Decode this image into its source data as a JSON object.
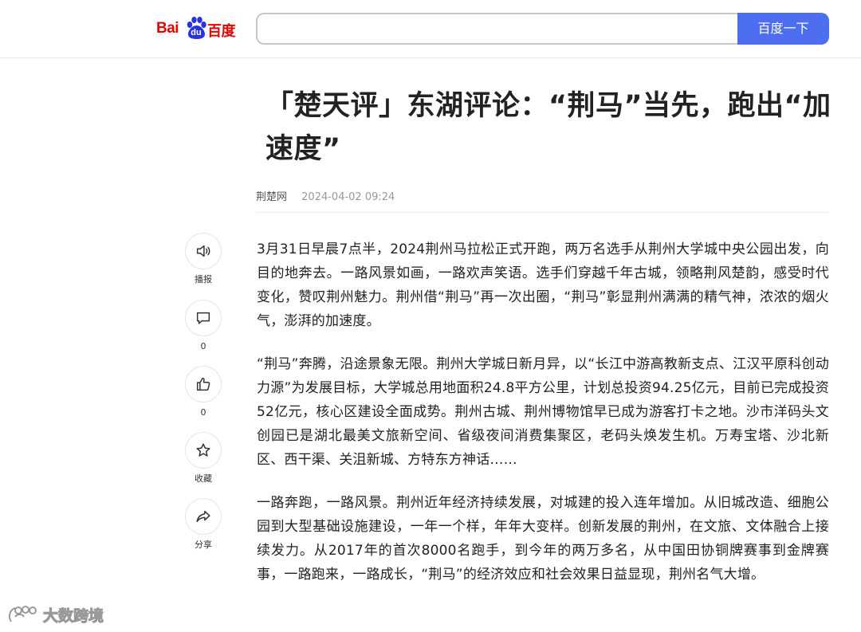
{
  "header": {
    "logo_bai": "Bai",
    "logo_du": "du",
    "logo_cn": "百度",
    "search_value": "",
    "search_button": "百度一下"
  },
  "article": {
    "title": "「楚天评」东湖评论：“荆马”当先，跑出“加速度”",
    "source": "荆楚网",
    "datetime": "2024-04-02 09:24",
    "paragraphs": [
      "3月31日早晨7点半，2024荆州马拉松正式开跑，两万名选手从荆州大学城中央公园出发，向目的地奔去。一路风景如画，一路欢声笑语。选手们穿越千年古城，领略荆风楚韵，感受时代变化，赞叹荆州魅力。荆州借“荆马”再一次出圈，“荆马”彰显荆州满满的精气神，浓浓的烟火气，澎湃的加速度。",
      "“荆马”奔腾，沿途景象无限。荆州大学城日新月异，以“长江中游高教新支点、江汉平原科创动力源”为发展目标，大学城总用地面积24.8平方公里，计划总投资94.25亿元，目前已完成投资52亿元，核心区建设全面成势。荆州古城、荆州博物馆早已成为游客打卡之地。沙市洋码头文创园已是湖北最美文旅新空间、省级夜间消费集聚区，老码头焕发生机。万寿宝塔、沙北新区、西干渠、关沮新城、方特东方神话……",
      "一路奔跑，一路风景。荆州近年经济持续发展，对城建的投入连年增加。从旧城改造、细胞公园到大型基础设施建设，一年一个样，年年大变样。创新发展的荆州，在文旅、文体融合上接续发力。从2017年的首次8000名跑手，到今年的两万多名，从中国田协铜牌赛事到金牌赛事，一路跑来，一路成长，“荆马”的经济效应和社会效果日益显现，荆州名气大增。"
    ]
  },
  "actions": [
    {
      "icon": "speaker-icon",
      "label": "播报"
    },
    {
      "icon": "comment-icon",
      "label": "0"
    },
    {
      "icon": "thumbs-up-icon",
      "label": "0"
    },
    {
      "icon": "star-icon",
      "label": "收藏"
    },
    {
      "icon": "share-icon",
      "label": "分享"
    }
  ],
  "watermark": {
    "text": "大数跨境"
  },
  "colors": {
    "brand_red": "#e10602",
    "button_blue": "#4e6ef2",
    "text": "#222222",
    "meta_gray": "#999999"
  }
}
